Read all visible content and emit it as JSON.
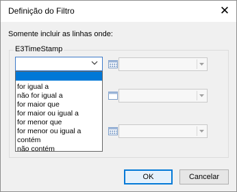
{
  "window": {
    "title": "Definição do Filtro",
    "close_glyph": "✕"
  },
  "instruction": "Somente incluir as linhas onde:",
  "group": {
    "label": "E3TimeStamp"
  },
  "operator_combo": {
    "selected_value": ""
  },
  "operator_options": [
    "",
    "for igual a",
    "não for igual a",
    "for maior que",
    "for maior ou igual a",
    "for menor que",
    "for menor ou igual a",
    "contém",
    "não contém"
  ],
  "buttons": {
    "ok": "OK",
    "cancel": "Cancelar"
  },
  "colors": {
    "selection": "#0078d7",
    "focus_border": "#3a78c7"
  },
  "icons": [
    "close-icon",
    "chevron-down-icon",
    "calendar-icon",
    "dropdown-arrow-icon"
  ]
}
